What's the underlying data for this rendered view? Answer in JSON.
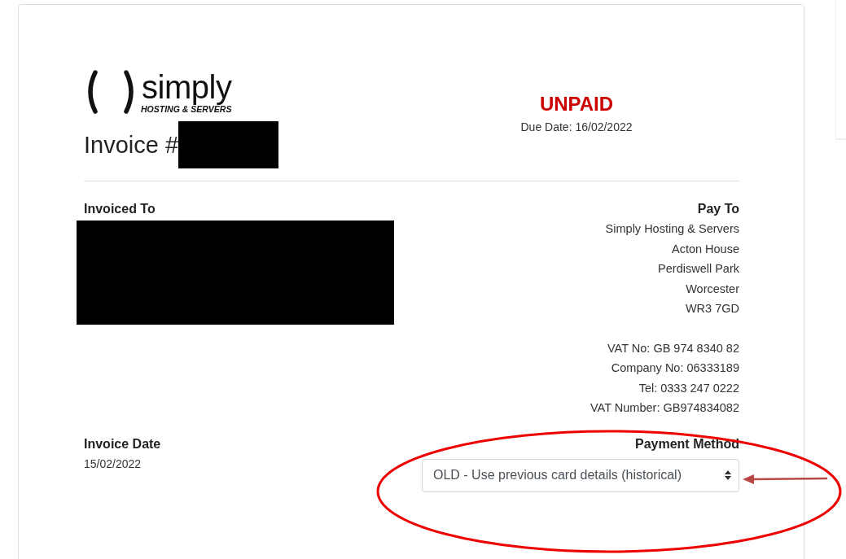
{
  "logo": {
    "name": "simply",
    "tagline": "HOSTING & SERVERS"
  },
  "invoice": {
    "title": "Invoice #",
    "status": {
      "label": "UNPAID",
      "kind": "unpaid"
    },
    "due_date": "Due Date: 16/02/2022"
  },
  "invoiced_to": {
    "heading": "Invoiced To"
  },
  "pay_to": {
    "heading": "Pay To",
    "address": [
      "Simply Hosting & Servers",
      "Acton House",
      "Perdiswell Park",
      "Worcester",
      "WR3 7GD"
    ],
    "details": [
      "VAT No: GB 974 8340 82",
      "Company No: 06333189",
      "Tel: 0333 247 0222",
      "VAT Number: GB974834082"
    ]
  },
  "invoice_date": {
    "heading": "Invoice Date",
    "value": "15/02/2022"
  },
  "payment_method": {
    "heading": "Payment Method",
    "value": "OLD - Use previous card details (historical)"
  }
}
